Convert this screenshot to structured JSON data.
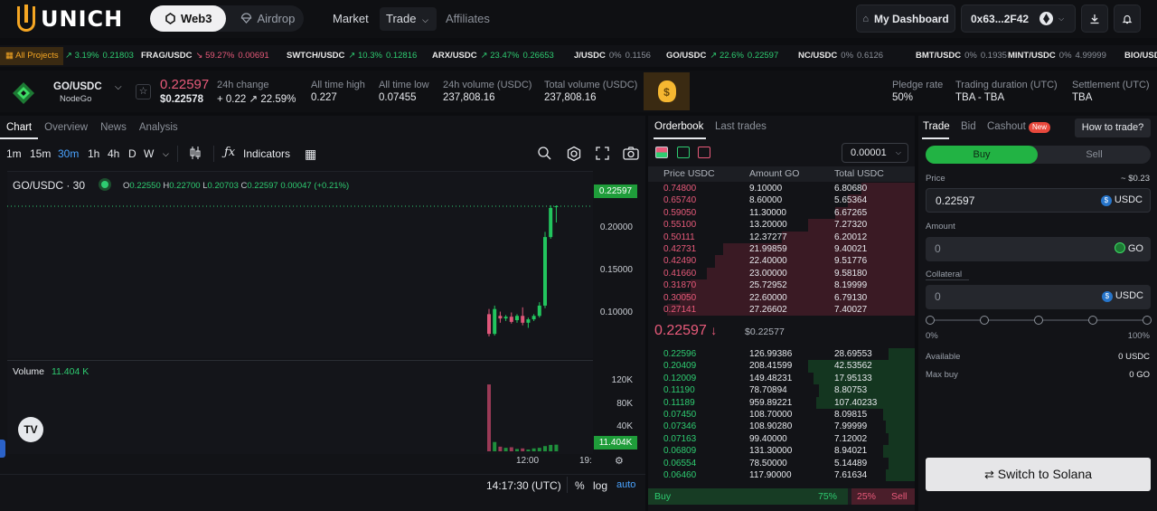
{
  "topnav": {
    "logo": "UNICH",
    "modes": [
      "Web3",
      "Airdrop"
    ],
    "links": [
      "Market",
      "Trade",
      "Affiliates"
    ],
    "dashboard": "My Dashboard",
    "wallet": "0x63...2F42"
  },
  "ticker": {
    "all_projects": "All Projects",
    "items": [
      {
        "pair": "",
        "change": "3.19%",
        "price": "0.21803",
        "dir": "up"
      },
      {
        "pair": "FRAG/USDC",
        "change": "59.27%",
        "price": "0.00691",
        "dir": "down"
      },
      {
        "pair": "SWTCH/USDC",
        "change": "10.3%",
        "price": "0.12816",
        "dir": "up"
      },
      {
        "pair": "ARX/USDC",
        "change": "23.47%",
        "price": "0.26653",
        "dir": "up"
      },
      {
        "pair": "J/USDC",
        "change": "0%",
        "price": "0.1156",
        "dir": "flat"
      },
      {
        "pair": "GO/USDC",
        "change": "22.6%",
        "price": "0.22597",
        "dir": "up"
      },
      {
        "pair": "NC/USDC",
        "change": "0%",
        "price": "0.6126",
        "dir": "flat"
      },
      {
        "pair": "BMT/USDC",
        "change": "0%",
        "price": "0.1935",
        "dir": "flat"
      },
      {
        "pair": "MINT/USDC",
        "change": "0%",
        "price": "4.99999",
        "dir": "flat"
      },
      {
        "pair": "BIO/USDC",
        "change": "",
        "price": "",
        "dir": "flat"
      }
    ]
  },
  "info": {
    "pair": "GO/USDC",
    "project": "NodeGo",
    "price": "0.22597",
    "price_usd": "$0.22578",
    "stats": [
      {
        "label": "24h change",
        "value": "+ 0.22",
        "extra": "22.59%"
      },
      {
        "label": "All time high",
        "value": "0.227"
      },
      {
        "label": "All time low",
        "value": "0.07455"
      },
      {
        "label": "24h volume (USDC)",
        "value": "237,808.16"
      },
      {
        "label": "Total volume (USDC)",
        "value": "237,808.16"
      }
    ],
    "right_stats": [
      {
        "label": "Pledge rate",
        "value": "50%"
      },
      {
        "label": "Trading duration (UTC)",
        "value": "TBA - TBA"
      },
      {
        "label": "Settlement (UTC)",
        "value": "TBA"
      }
    ]
  },
  "chart_panel": {
    "tabs": [
      "Chart",
      "Overview",
      "News",
      "Analysis"
    ],
    "intervals": [
      "1m",
      "15m",
      "30m",
      "1h",
      "4h",
      "D",
      "W"
    ],
    "active_interval": "30m",
    "indicators_label": "Indicators",
    "symbol": "GO/USDC · 30",
    "ohlc": {
      "o": "0.22550",
      "h": "0.22700",
      "l": "0.20703",
      "c": "0.22597",
      "chg": "0.00047 (+0.21%)"
    },
    "volume_label": "Volume",
    "volume_value": "11.404 K",
    "last_price_tag": "0.22597",
    "last_volume_tag": "11.404K",
    "time_label": "14:17:30 (UTC)",
    "x_labels": [
      "12:00",
      "19:"
    ],
    "bottom": {
      "pct": "%",
      "log": "log",
      "auto": "auto"
    }
  },
  "chart_data": {
    "type": "candlestick",
    "title": "GO/USDC · 30",
    "y_ticks": [
      0.1,
      0.15,
      0.2
    ],
    "y_tick_labels": [
      "0.10000",
      "0.15000",
      "0.20000"
    ],
    "ylim": [
      0.055,
      0.245
    ],
    "volume_ticks": [
      "120K",
      "80K",
      "40K"
    ],
    "volume_ylim": [
      0,
      140000
    ],
    "candles": [
      {
        "o": 0.1,
        "h": 0.106,
        "l": 0.074,
        "c": 0.077
      },
      {
        "o": 0.077,
        "h": 0.11,
        "l": 0.075,
        "c": 0.106
      },
      {
        "o": 0.098,
        "h": 0.103,
        "l": 0.09,
        "c": 0.095
      },
      {
        "o": 0.095,
        "h": 0.099,
        "l": 0.092,
        "c": 0.097
      },
      {
        "o": 0.097,
        "h": 0.102,
        "l": 0.089,
        "c": 0.091
      },
      {
        "o": 0.093,
        "h": 0.1,
        "l": 0.09,
        "c": 0.098
      },
      {
        "o": 0.098,
        "h": 0.108,
        "l": 0.087,
        "c": 0.09
      },
      {
        "o": 0.09,
        "h": 0.096,
        "l": 0.084,
        "c": 0.094
      },
      {
        "o": 0.094,
        "h": 0.1,
        "l": 0.092,
        "c": 0.098
      },
      {
        "o": 0.098,
        "h": 0.114,
        "l": 0.096,
        "c": 0.11
      },
      {
        "o": 0.11,
        "h": 0.196,
        "l": 0.107,
        "c": 0.19
      },
      {
        "o": 0.19,
        "h": 0.227,
        "l": 0.188,
        "c": 0.224
      },
      {
        "o": 0.2255,
        "h": 0.227,
        "l": 0.207,
        "c": 0.22597
      }
    ],
    "volumes": [
      115000,
      16000,
      8000,
      6000,
      7000,
      4000,
      5000,
      3000,
      5000,
      6000,
      9000,
      11000,
      11404
    ]
  },
  "orderbook": {
    "tabs": [
      "Orderbook",
      "Last trades"
    ],
    "precision": "0.00001",
    "headers": [
      "Price USDC",
      "Amount GO",
      "Total USDC"
    ],
    "asks": [
      [
        "0.74800",
        "9.10000",
        "6.80680"
      ],
      [
        "0.65740",
        "8.60000",
        "5.65364"
      ],
      [
        "0.59050",
        "11.30000",
        "6.67265"
      ],
      [
        "0.55100",
        "13.20000",
        "7.27320"
      ],
      [
        "0.50111",
        "12.37277",
        "6.20012"
      ],
      [
        "0.42731",
        "21.99859",
        "9.40021"
      ],
      [
        "0.42490",
        "22.40000",
        "9.51776"
      ],
      [
        "0.41660",
        "23.00000",
        "9.58180"
      ],
      [
        "0.31870",
        "25.72952",
        "8.19999"
      ],
      [
        "0.30050",
        "22.60000",
        "6.79130"
      ],
      [
        "0.27141",
        "27.26602",
        "7.40027"
      ]
    ],
    "last_price": "0.22597",
    "last_usd": "$0.22577",
    "bids": [
      [
        "0.22596",
        "126.99386",
        "28.69553"
      ],
      [
        "0.20409",
        "208.41599",
        "42.53562"
      ],
      [
        "0.12009",
        "149.48231",
        "17.95133"
      ],
      [
        "0.11190",
        "78.70894",
        "8.80753"
      ],
      [
        "0.11189",
        "959.89221",
        "107.40233"
      ],
      [
        "0.07450",
        "108.70000",
        "8.09815"
      ],
      [
        "0.07346",
        "108.90280",
        "7.99999"
      ],
      [
        "0.07163",
        "99.40000",
        "7.12002"
      ],
      [
        "0.06809",
        "131.30000",
        "8.94021"
      ],
      [
        "0.06554",
        "78.50000",
        "5.14489"
      ],
      [
        "0.06460",
        "117.90000",
        "7.61634"
      ]
    ],
    "ask_depth": [
      0.2,
      0.25,
      0.3,
      0.4,
      0.5,
      0.72,
      0.75,
      0.78,
      0.84,
      0.88,
      0.93
    ],
    "bid_depth": [
      0.1,
      0.4,
      0.38,
      0.36,
      0.37,
      0.12,
      0.11,
      0.1,
      0.12,
      0.1,
      0.11
    ],
    "buy_label": "Buy",
    "buy_pct": "75%",
    "sell_label": "Sell",
    "sell_pct": "25%",
    "buy_ratio": 0.75
  },
  "trade": {
    "tabs": [
      "Trade",
      "Bid",
      "Cashout"
    ],
    "new_badge": "New",
    "how_to": "How to trade?",
    "buy": "Buy",
    "sell": "Sell",
    "price_label": "Price",
    "price_hint": "~ $0.23",
    "price_value": "0.22597",
    "price_unit": "USDC",
    "amount_label": "Amount",
    "amount_value": "0",
    "amount_unit": "GO",
    "collateral_label": "Collateral",
    "collateral_value": "0",
    "collateral_unit": "USDC",
    "slider_min": "0%",
    "slider_max": "100%",
    "available_label": "Available",
    "available_value": "0 USDC",
    "maxbuy_label": "Max buy",
    "maxbuy_value": "0 GO",
    "switch": "Switch to Solana"
  },
  "colors": {
    "up": "#2ecc71",
    "down": "#e85a7a",
    "accent": "#f5a623",
    "link": "#4aa3ff"
  }
}
